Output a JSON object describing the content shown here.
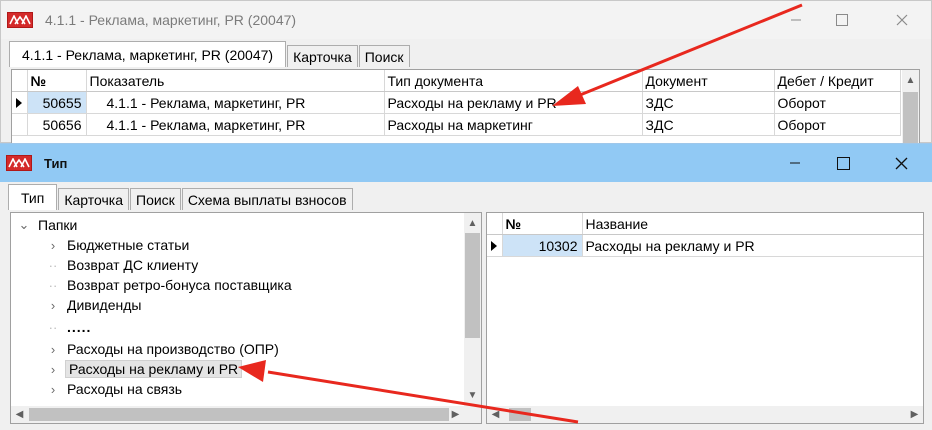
{
  "window1": {
    "title": "4.1.1 - Реклама, маркетинг, PR (20047)",
    "tabs": [
      "4.1.1 - Реклама, маркетинг, PR (20047)",
      "Карточка",
      "Поиск"
    ],
    "table": {
      "columns": [
        "№",
        "Показатель",
        "Тип документа",
        "Документ",
        "Дебет / Кредит"
      ],
      "rows": [
        [
          "50655",
          "4.1.1 - Реклама, маркетинг, PR",
          "Расходы на рекламу и PR",
          "ЗДС",
          "Оборот"
        ],
        [
          "50656",
          "4.1.1 - Реклама, маркетинг, PR",
          "Расходы на маркетинг",
          "ЗДС",
          "Оборот"
        ]
      ]
    }
  },
  "window2": {
    "title": "Тип",
    "tabs": [
      "Тип",
      "Карточка",
      "Поиск",
      "Схема выплаты взносов"
    ],
    "tree": {
      "root": "Папки",
      "items": [
        "Бюджетные статьи",
        "Возврат ДС клиенту",
        "Возврат ретро-бонуса поставщика",
        "Дивиденды",
        ".....",
        "Расходы на производство (ОПР)",
        "Расходы на рекламу и PR",
        "Расходы на связь"
      ]
    },
    "list": {
      "columns": [
        "№",
        "Название"
      ],
      "rows": [
        [
          "10302",
          "Расходы на рекламу и PR"
        ]
      ]
    }
  },
  "colors": {
    "active_titlebar": "#91c9f4",
    "selection": "#cde3f7",
    "annotation_arrow": "#e8281e",
    "app_icon": "#d42a2a"
  },
  "icons": [
    "app-logo-icon",
    "minimize-icon",
    "maximize-icon",
    "close-icon",
    "chevron-right-icon",
    "chevron-down-icon",
    "row-pointer-icon"
  ]
}
